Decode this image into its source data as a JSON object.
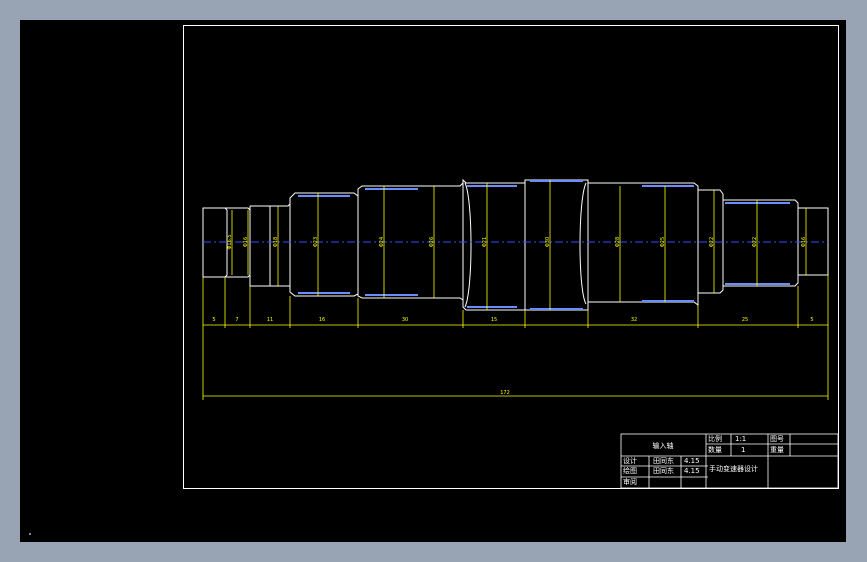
{
  "title_block": {
    "part_name": "输入轴",
    "scale_label": "比例",
    "scale_value": "1:1",
    "drawing_no_label": "图号",
    "qty_label": "数量",
    "qty_value": "1",
    "weight_label": "重量",
    "design_label": "设计",
    "design_name": "田同东",
    "design_date": "4.15",
    "draw_label": "绘图",
    "draw_name": "田同东",
    "draw_date": "4.15",
    "review_label": "审阅",
    "project_title": "手动变速器设计"
  },
  "dimensions": {
    "lengths": [
      "5",
      "7",
      "11",
      "16",
      "30",
      "15",
      "32",
      "25",
      "5"
    ],
    "total_length": "172",
    "diameters": [
      "Φ16.5",
      "Φ16",
      "Φ18",
      "Φ23",
      "Φ24",
      "Φ26",
      "Φ21",
      "Φ30",
      "Φ28",
      "Φ25",
      "Φ22",
      "Φ22",
      "Φ16"
    ]
  },
  "colors": {
    "background": "#000000",
    "frame": "#ffffff",
    "outline": "#ffffff",
    "dimension": "#ffff00",
    "centerline": "#3050ff",
    "chamfer": "#6a8cff"
  }
}
